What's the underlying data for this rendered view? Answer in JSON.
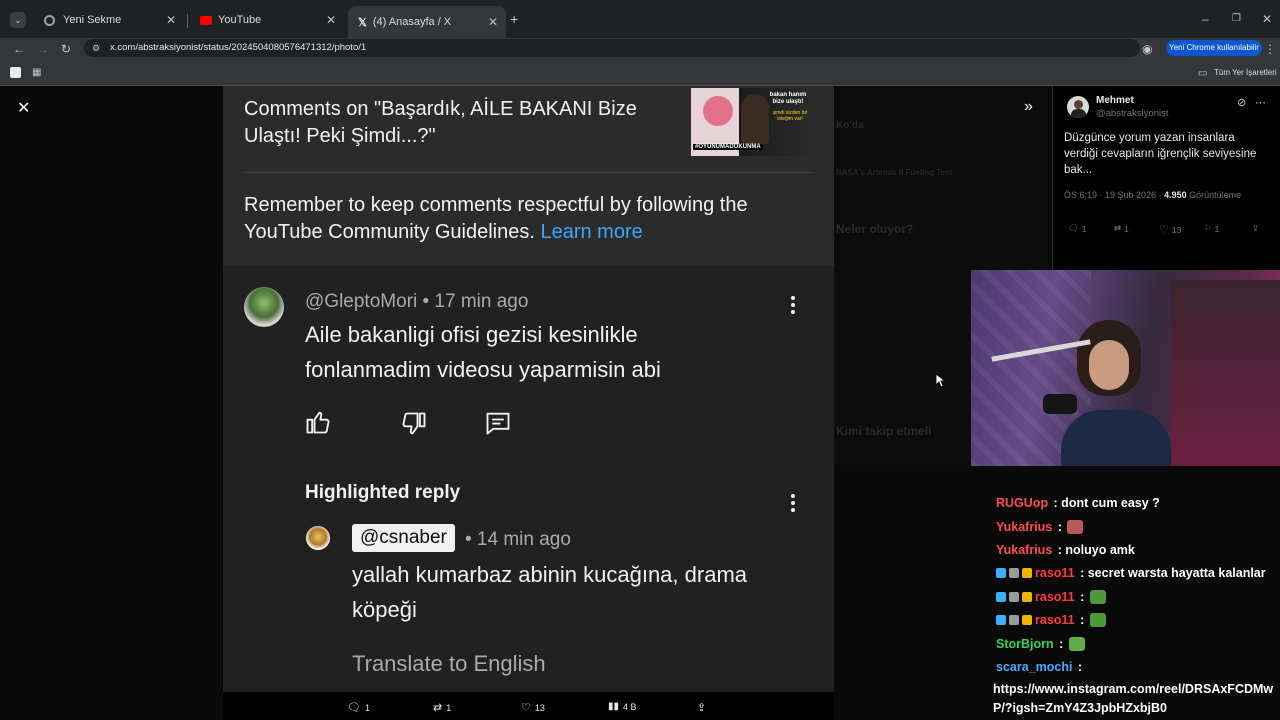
{
  "browser": {
    "tabs": [
      {
        "title": "Yeni Sekme",
        "icon": "chrome-icon"
      },
      {
        "title": "YouTube",
        "icon": "youtube-icon"
      },
      {
        "title": "(4) Anasayfa / X",
        "icon": "x-icon"
      }
    ],
    "active_tab": 2,
    "url": "x.com/abstraksiyonist/status/2024504080576471312/photo/1",
    "chrome_pill": "Yeni Chrome kullanılabilir",
    "all_bookmarks": "Tüm Yer İşaretleri"
  },
  "youtube": {
    "comments_title": "Comments on \"Başardık, AİLE BAKANI Bize Ulaştı! Peki Şimdi...?\"",
    "thumbnail": {
      "text_top": "bakan hanım bize ulaştı!",
      "text_mid": "şimdi sizden bir isteğim var!",
      "hashtag": "#OYUNUMADOKUNMA"
    },
    "notice": "Remember to keep comments respectful by following the YouTube Community Guidelines.",
    "learn_more": "Learn more",
    "comment": {
      "handle": "@GleptoMori",
      "time": "• 17 min ago",
      "text": "Aile bakanligi ofisi gezisi kesinlikle fonlanmadim videosu yaparmisin abi"
    },
    "highlighted_label": "Highlighted reply",
    "reply": {
      "handle": "@csnaber",
      "time": "• 14 min ago",
      "text": "yallah kumarbaz abinin kucağına, drama köpeği"
    },
    "translate": "Translate to English"
  },
  "photo_actions": {
    "replies": "1",
    "reposts": "1",
    "likes": "13",
    "views": "4 B"
  },
  "tweet": {
    "name": "Mehmet",
    "handle": "@abstraksiyonist",
    "text": "Düzgünce yorum yazan insanlara verdiği cevapların iğrençlik seviyesine bak...",
    "time": "ÖS 6:19 · 19 Şub 2026 · ",
    "views": "4.950",
    "views_label": " Görüntüleme",
    "replies": "1",
    "reposts": "1",
    "likes": "13",
    "bookmarks": "1"
  },
  "chat": [
    {
      "user": "RUGUop",
      "color": "#ff4d4d",
      "msg": " : dont cum easy ?",
      "badges": [],
      "emote": null
    },
    {
      "user": "Yukafrius",
      "color": "#ff4d4d",
      "msg": " : ",
      "badges": [],
      "emote": "#b85a5a"
    },
    {
      "user": "Yukafrius",
      "color": "#ff4d4d",
      "msg": " : noluyo amk",
      "badges": [],
      "emote": null
    },
    {
      "user": "raso11",
      "color": "#ff3b3b",
      "msg": " : secret warsta hayatta kalanlar",
      "badges": [
        "#3ab0ff",
        "#9b9b9b",
        "#f0b400"
      ],
      "emote": null
    },
    {
      "user": "raso11",
      "color": "#ff3b3b",
      "msg": " : ",
      "badges": [
        "#3ab0ff",
        "#9b9b9b",
        "#f0b400"
      ],
      "emote": "#4c9a3c"
    },
    {
      "user": "raso11",
      "color": "#ff3b3b",
      "msg": " : ",
      "badges": [
        "#3ab0ff",
        "#9b9b9b",
        "#f0b400"
      ],
      "emote": "#4c9a3c"
    },
    {
      "user": "StorBjorn",
      "color": "#39d353",
      "msg": " : ",
      "badges": [],
      "emote": "#5fae4a"
    },
    {
      "user": "scara_mochi",
      "color": "#4aa8ff",
      "msg": " :",
      "badges": [],
      "emote": null
    }
  ],
  "chat_link": "https://www.instagram.com/reel/DRSAxFCDMwP/?igsh=ZmY4Z3JpbHZxbjB0"
}
